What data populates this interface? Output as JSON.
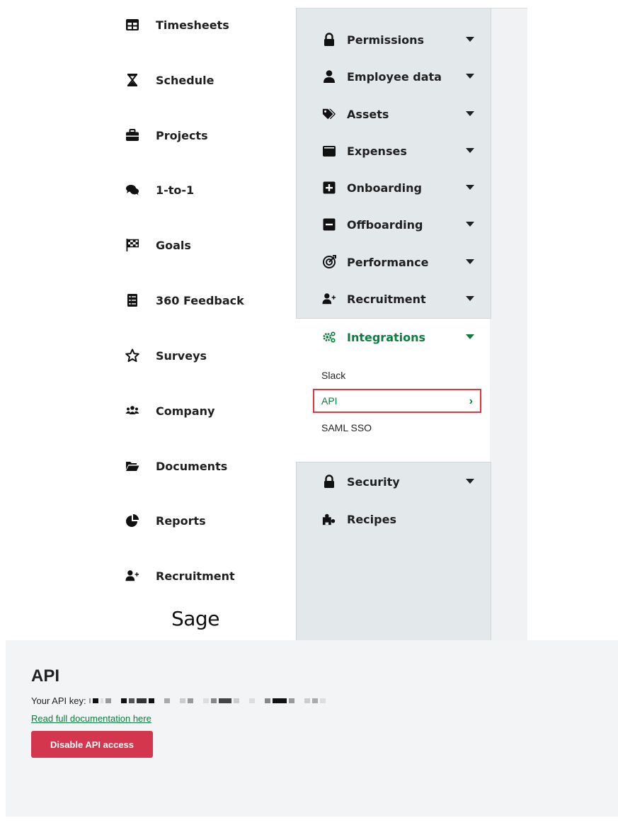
{
  "left_nav": {
    "items": [
      {
        "label": "Timesheets",
        "icon": "table-icon"
      },
      {
        "label": "Schedule",
        "icon": "hourglass-icon"
      },
      {
        "label": "Projects",
        "icon": "briefcase-icon"
      },
      {
        "label": "1-to-1",
        "icon": "chat-bubbles-icon"
      },
      {
        "label": "Goals",
        "icon": "checkered-flag-icon"
      },
      {
        "label": "360 Feedback",
        "icon": "clipboard-list-icon"
      },
      {
        "label": "Surveys",
        "icon": "star-icon"
      },
      {
        "label": "Company",
        "icon": "people-group-icon"
      },
      {
        "label": "Documents",
        "icon": "folder-open-icon"
      },
      {
        "label": "Reports",
        "icon": "pie-chart-icon"
      },
      {
        "label": "Recruitment",
        "icon": "user-plus-icon"
      }
    ],
    "logo": "Sage"
  },
  "settings_menu": {
    "items": [
      {
        "label": "Permissions",
        "icon": "lock-icon"
      },
      {
        "label": "Employee data",
        "icon": "user-icon"
      },
      {
        "label": "Assets",
        "icon": "tags-icon"
      },
      {
        "label": "Expenses",
        "icon": "wallet-icon"
      },
      {
        "label": "Onboarding",
        "icon": "plus-square-icon"
      },
      {
        "label": "Offboarding",
        "icon": "minus-square-icon"
      },
      {
        "label": "Performance",
        "icon": "target-icon"
      },
      {
        "label": "Recruitment",
        "icon": "user-plus-icon"
      }
    ],
    "integrations": {
      "label": "Integrations",
      "icon": "gears-icon",
      "sub_items": [
        "Slack",
        "API",
        "SAML SSO"
      ],
      "selected": "API"
    },
    "bottom_items": [
      {
        "label": "Security",
        "icon": "lock-icon"
      },
      {
        "label": "Recipes",
        "icon": "puzzle-icon"
      }
    ]
  },
  "api_section": {
    "title": "API",
    "key_label": "Your API key:",
    "doc_link": "Read full documentation here",
    "disable_button": "Disable API access"
  },
  "colors": {
    "accent_green": "#0b7e3e",
    "danger": "#d4374d",
    "highlight_border": "#e8333a"
  }
}
